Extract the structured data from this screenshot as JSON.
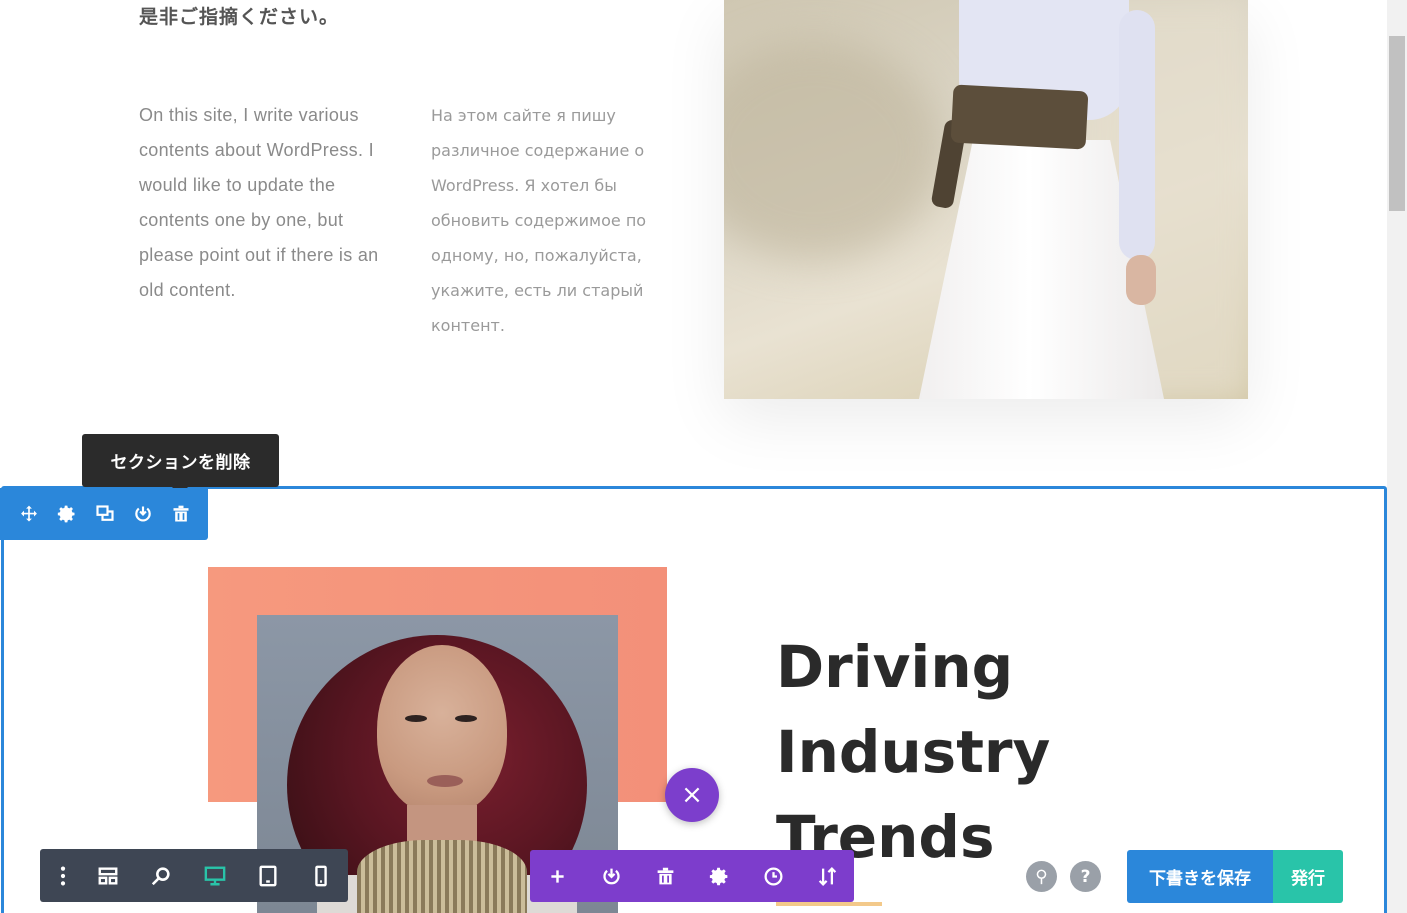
{
  "content": {
    "jp_line": "是非ご指摘ください。",
    "en_paragraph": "On this site, I write various contents about WordPress. I would like to update the contents one by one, but please point out if there is an old content.",
    "ru_paragraph": "На этом сайте я пишу различное содержание о WordPress. Я хотел бы обновить содержимое по одному, но, пожалуйста, укажите, есть ли старый контент."
  },
  "section": {
    "tooltip": "セクションを削除",
    "toolbar_icons": [
      "move-icon",
      "gear-icon",
      "duplicate-icon",
      "save-to-library-icon",
      "trash-icon"
    ],
    "frame_color": "#2b87da"
  },
  "feature": {
    "heading_lines": [
      "Driving",
      "Industry",
      "Trends"
    ],
    "accent_color": "#f39079"
  },
  "builder_bar": {
    "page_icons": [
      "kebab-menu-icon",
      "wireframe-icon",
      "zoom-icon",
      "desktop-icon",
      "tablet-icon",
      "phone-icon"
    ],
    "active_view": "desktop",
    "row_icons": [
      "add-icon",
      "save-icon",
      "trash-icon",
      "gear-icon",
      "history-icon",
      "sort-icon"
    ],
    "close_symbol": "×",
    "search_symbol": "⚲",
    "help_symbol": "?",
    "save_draft_label": "下書きを保存",
    "publish_label": "発行",
    "colors": {
      "blue": "#2b87da",
      "green": "#29c4a9",
      "purple": "#7d3dcc",
      "dark": "#3e4654"
    }
  }
}
